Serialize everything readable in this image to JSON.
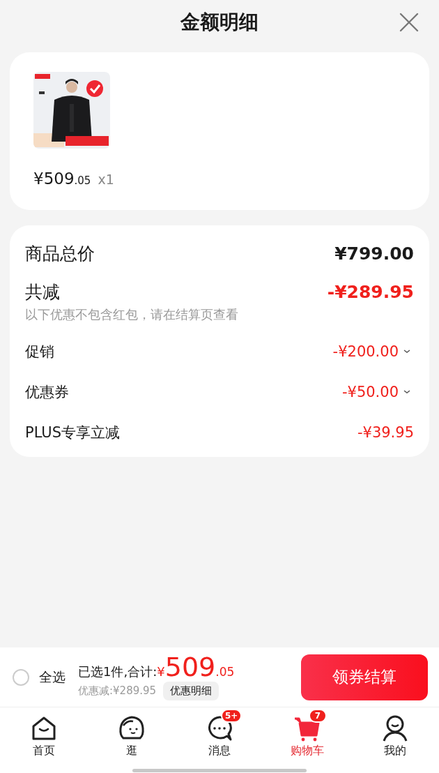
{
  "header": {
    "title": "金额明细"
  },
  "product": {
    "price_integer": "¥509",
    "price_decimal": ".05",
    "quantity": "x1"
  },
  "summary": {
    "total_label": "商品总价",
    "total_value": "¥799.00",
    "discount_label": "共减",
    "discount_value": "-¥289.95",
    "note": "以下优惠不包含红包，请在结算页查看",
    "items": [
      {
        "label": "促销",
        "value": "-¥200.00",
        "expandable": true
      },
      {
        "label": "优惠券",
        "value": "-¥50.00",
        "expandable": true
      },
      {
        "label": "PLUS专享立减",
        "value": "-¥39.95",
        "expandable": false
      }
    ]
  },
  "checkout": {
    "select_all": {
      "label": "全选",
      "checked": false
    },
    "selected_label": "已选1件,合计:",
    "currency": "¥",
    "total_integer": "509",
    "total_decimal": ".05",
    "saved": "优惠减:¥289.95",
    "details_button": "优惠明细",
    "submit_button": "领券结算"
  },
  "tabs": [
    {
      "label": "首页",
      "kind": "home",
      "selected": false
    },
    {
      "label": "逛",
      "kind": "browse",
      "selected": false
    },
    {
      "label": "消息",
      "kind": "message",
      "selected": false,
      "badge": "5+"
    },
    {
      "label": "购物车",
      "kind": "cart",
      "selected": true,
      "badge": "7"
    },
    {
      "label": "我的",
      "kind": "profile",
      "selected": false
    }
  ]
}
